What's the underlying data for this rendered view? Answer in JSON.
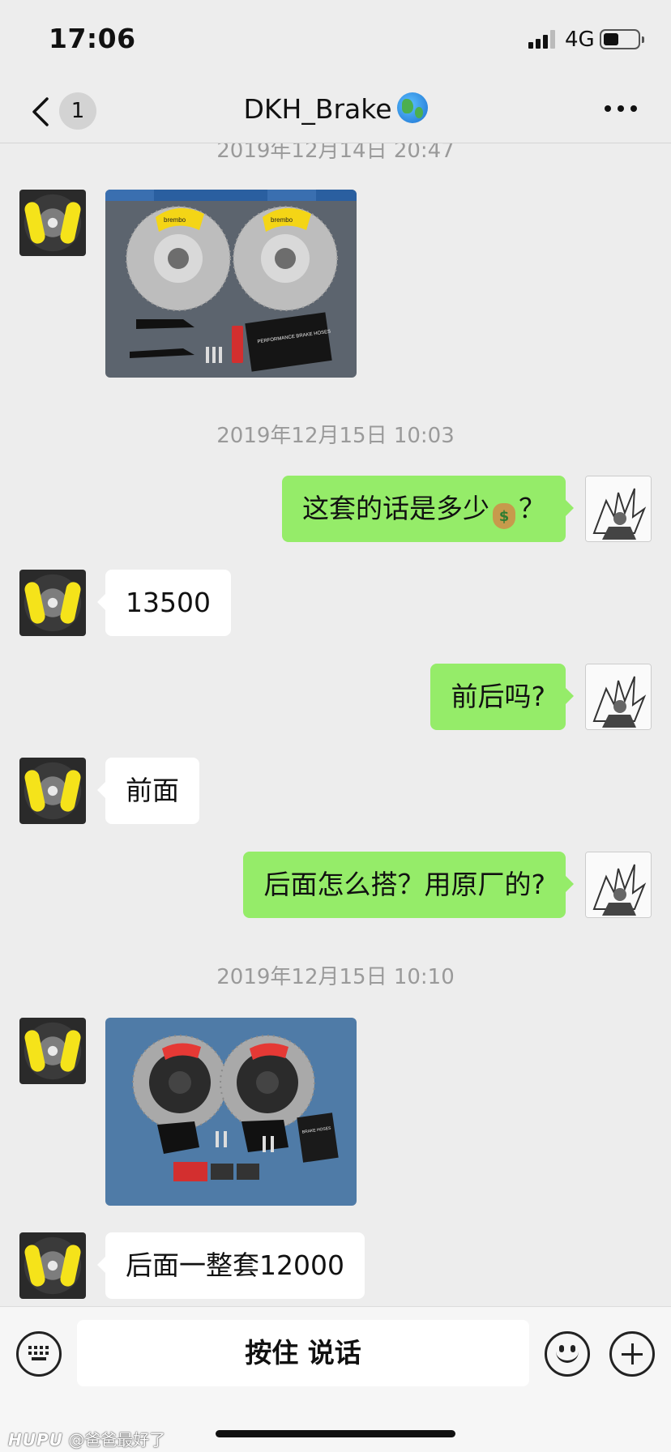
{
  "status_bar": {
    "time": "17:06",
    "network": "4G",
    "battery_level": 0.45
  },
  "nav": {
    "back_count": "1",
    "title": "DKH_Brake",
    "title_emoji": "globe-icon",
    "more_icon": "more-icon"
  },
  "messages": {
    "ts0": "2019年12月14日 20:47",
    "ts1": "2019年12月15日 10:03",
    "m1_pre": "这套的话是多少",
    "m1_post": "？",
    "m2": "13500",
    "m3": "前后吗?",
    "m4": "前面",
    "m5": "后面怎么搭？用原厂的?",
    "ts2": "2019年12月15日 10:10",
    "m6": "后面一整套12000",
    "img1_brand": "brembo",
    "img1_label": "PERFORMANCE BRAKE HOSES",
    "img2_label": "BRAKE HOSES"
  },
  "input_bar": {
    "hold_to_talk": "按住 说话"
  },
  "watermark": {
    "brand": "HUPU",
    "user": "@爸爸最好了"
  },
  "colors": {
    "outgoing_bubble": "#95ec69",
    "incoming_bubble": "#ffffff",
    "background": "#ededed",
    "timestamp": "#9a9a9a"
  }
}
